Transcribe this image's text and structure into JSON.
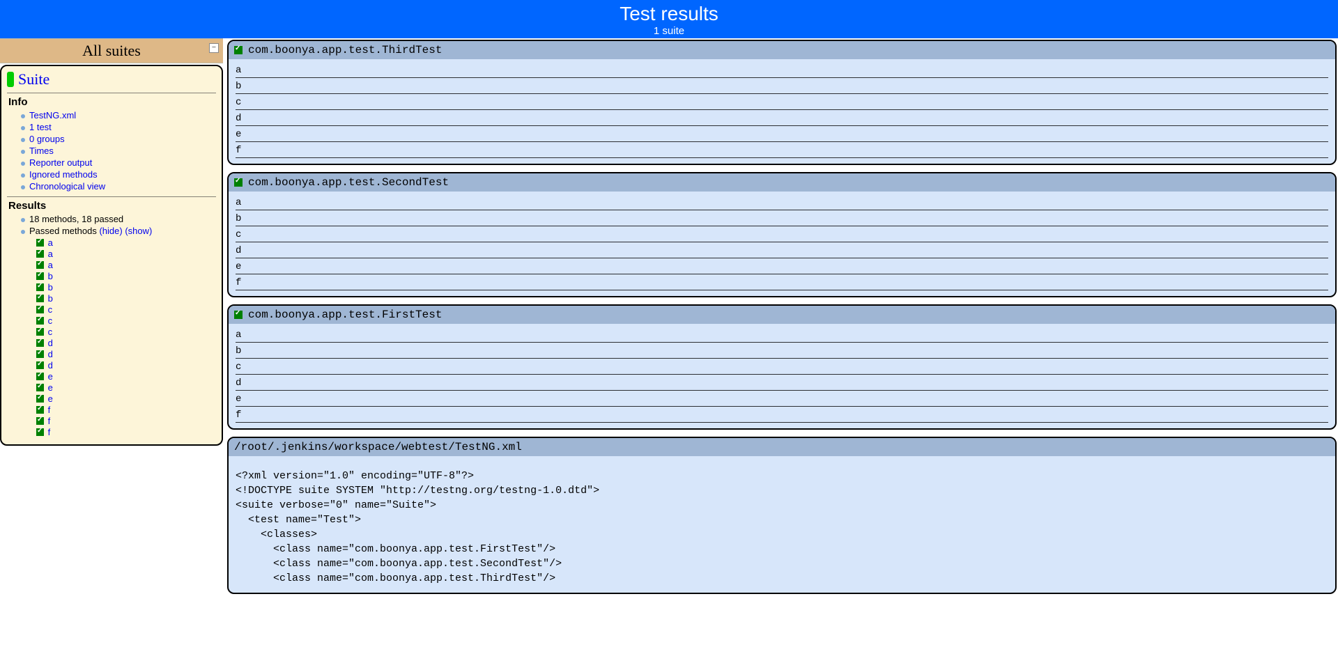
{
  "header": {
    "title": "Test results",
    "subtitle": "1 suite"
  },
  "sidebar": {
    "all_suites": "All suites",
    "suite_name": "Suite",
    "info_label": "Info",
    "info_items": [
      "TestNG.xml",
      "1 test",
      "0 groups",
      "Times",
      "Reporter output",
      "Ignored methods",
      "Chronological view"
    ],
    "results_label": "Results",
    "summary": "18 methods, 18 passed",
    "passed_methods_label": "Passed methods",
    "hide_label": "(hide)",
    "show_label": "(show)",
    "methods": [
      "a",
      "a",
      "a",
      "b",
      "b",
      "b",
      "c",
      "c",
      "c",
      "d",
      "d",
      "d",
      "e",
      "e",
      "e",
      "f",
      "f",
      "f"
    ]
  },
  "panels": [
    {
      "class": "com.boonya.app.test.ThirdTest",
      "tests": [
        "a",
        "b",
        "c",
        "d",
        "e",
        "f"
      ]
    },
    {
      "class": "com.boonya.app.test.SecondTest",
      "tests": [
        "a",
        "b",
        "c",
        "d",
        "e",
        "f"
      ]
    },
    {
      "class": "com.boonya.app.test.FirstTest",
      "tests": [
        "a",
        "b",
        "c",
        "d",
        "e",
        "f"
      ]
    }
  ],
  "xml": {
    "path": "/root/.jenkins/workspace/webtest/TestNG.xml",
    "content": "<?xml version=\"1.0\" encoding=\"UTF-8\"?>\n<!DOCTYPE suite SYSTEM \"http://testng.org/testng-1.0.dtd\">\n<suite verbose=\"0\" name=\"Suite\">\n  <test name=\"Test\">\n    <classes>\n      <class name=\"com.boonya.app.test.FirstTest\"/>\n      <class name=\"com.boonya.app.test.SecondTest\"/>\n      <class name=\"com.boonya.app.test.ThirdTest\"/>"
  }
}
